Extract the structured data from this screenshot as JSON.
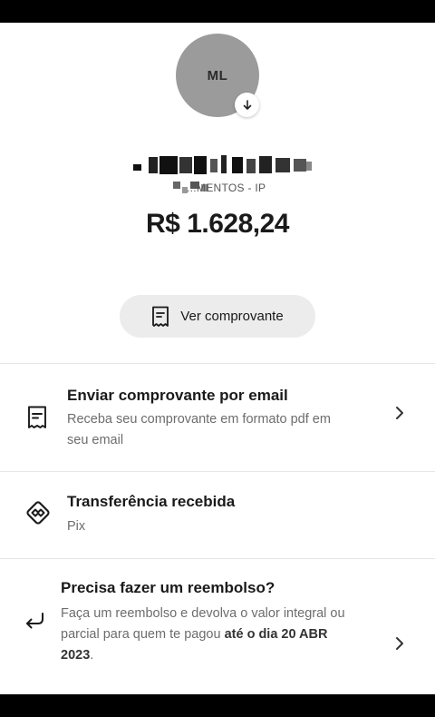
{
  "profile": {
    "initials": "ML",
    "name_redacted": "",
    "location_partial": "...MENTOS - IP"
  },
  "transaction": {
    "amount": "R$ 1.628,24"
  },
  "buttons": {
    "view_receipt": "Ver comprovante"
  },
  "email_receipt": {
    "title": "Enviar comprovante por email",
    "subtitle_line1": "Receba seu comprovante em formato pdf em",
    "subtitle_line2": "seu email"
  },
  "transfer": {
    "title": "Transferência recebida",
    "subtitle": "Pix"
  },
  "refund": {
    "title": "Precisa fazer um reembolso?",
    "line1": "Faça um reembolso e devolva o valor integral ou",
    "line2_pre": "parcial para quem te pagou ",
    "line2_bold": "até o dia 20 ABR",
    "line3_bold": "2023",
    "line3_post": "."
  },
  "icons": {
    "avatar_badge": "arrow-down-icon",
    "receipt": "receipt-icon",
    "pix": "pix-icon",
    "refund": "return-arrow-icon",
    "chevron": "chevron-right-icon"
  }
}
